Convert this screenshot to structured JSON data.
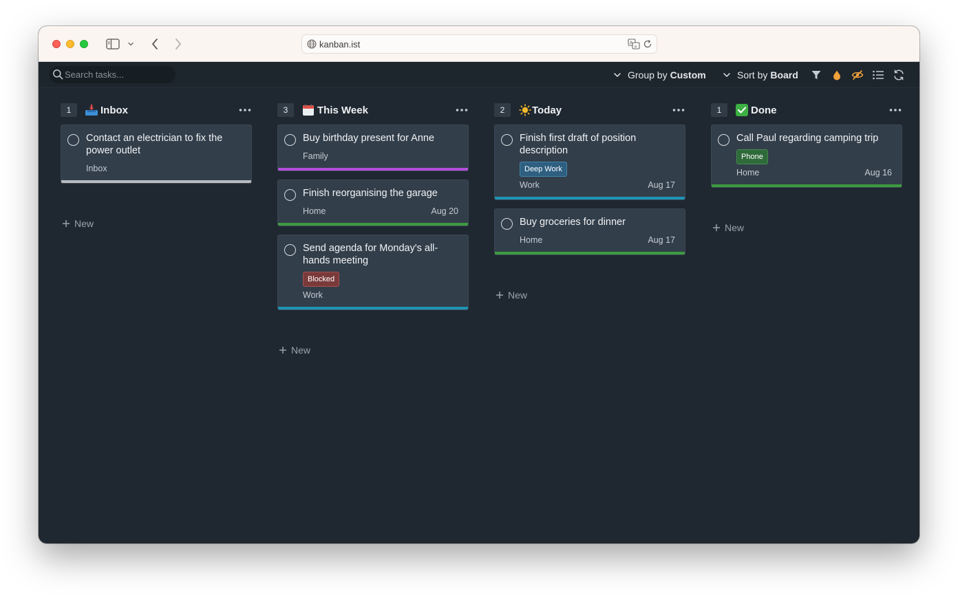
{
  "browser": {
    "url": "kanban.ist"
  },
  "toolbar": {
    "search_placeholder": "Search tasks...",
    "group_by_label": "Group by",
    "group_by_value": "Custom",
    "sort_by_label": "Sort by",
    "sort_by_value": "Board",
    "icons": [
      "filter-icon",
      "drop-icon",
      "eye-slash-icon",
      "list-icon",
      "refresh-icon"
    ]
  },
  "columns": [
    {
      "count": "1",
      "emoji": "inbox-tray-icon",
      "title": "Inbox",
      "new_label": "New",
      "cards": [
        {
          "title": "Contact an electrician to fix the power outlet",
          "project": "Inbox",
          "date": "",
          "tag": "",
          "color": "#b8bcc0"
        }
      ]
    },
    {
      "count": "3",
      "emoji": "calendar-icon",
      "title": "This Week",
      "new_label": "New",
      "cards": [
        {
          "title": "Buy birthday present for Anne",
          "project": "Family",
          "date": "",
          "tag": "",
          "color": "#b34ed9"
        },
        {
          "title": "Finish reorganising the garage",
          "project": "Home",
          "date": "Aug 20",
          "tag": "",
          "color": "#3d9a3f"
        },
        {
          "title": "Send agenda for Monday's all-hands meeting",
          "project": "Work",
          "date": "",
          "tag": "Blocked",
          "tag_color": "#7a3a3a",
          "color": "#1f93b4"
        }
      ]
    },
    {
      "count": "2",
      "emoji": "sun-icon",
      "title": "Today",
      "new_label": "New",
      "cards": [
        {
          "title": "Finish first draft of position description",
          "project": "Work",
          "date": "Aug 17",
          "tag": "Deep Work",
          "tag_color": "#2e5f80",
          "color": "#1f93b4"
        },
        {
          "title": "Buy groceries for dinner",
          "project": "Home",
          "date": "Aug 17",
          "tag": "",
          "color": "#3d9a3f"
        }
      ]
    },
    {
      "count": "1",
      "emoji": "check-mark-icon",
      "title": "Done",
      "new_label": "New",
      "cards": [
        {
          "title": "Call Paul regarding camping trip",
          "project": "Home",
          "date": "Aug 16",
          "tag": "Phone",
          "tag_color": "#2f6a3a",
          "color": "#3d9a3f"
        }
      ]
    }
  ]
}
